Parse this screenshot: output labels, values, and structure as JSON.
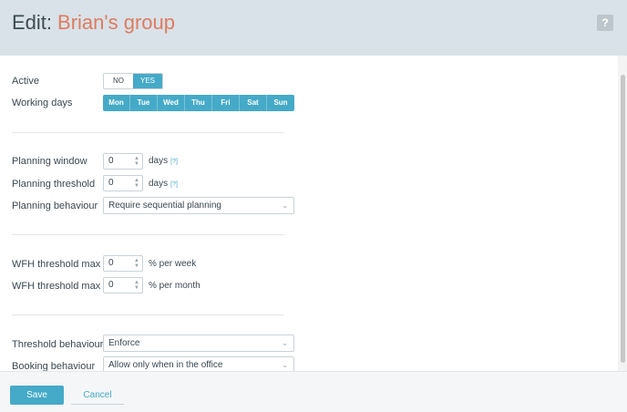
{
  "header": {
    "edit_label": "Edit:",
    "group_name": "Brian's group",
    "help_label": "?"
  },
  "active": {
    "label": "Active",
    "options": [
      "NO",
      "YES"
    ],
    "selected": "YES"
  },
  "working_days": {
    "label": "Working days",
    "days": [
      "Mon",
      "Tue",
      "Wed",
      "Thu",
      "Fri",
      "Sat",
      "Sun"
    ]
  },
  "planning_window": {
    "label": "Planning window",
    "value": "0",
    "unit": "days",
    "hint": "[?]"
  },
  "planning_threshold": {
    "label": "Planning threshold",
    "value": "0",
    "unit": "days",
    "hint": "[?]"
  },
  "planning_behaviour": {
    "label": "Planning behaviour",
    "value": "Require sequential planning"
  },
  "wfh_week": {
    "label": "WFH threshold max",
    "value": "0",
    "unit": "% per week"
  },
  "wfh_month": {
    "label": "WFH threshold max",
    "value": "0",
    "unit": "% per month"
  },
  "threshold_behaviour": {
    "label": "Threshold behaviour",
    "value": "Enforce"
  },
  "booking_behaviour": {
    "label": "Booking behaviour",
    "value": "Allow only when in the office"
  },
  "footer": {
    "save_label": "Save",
    "cancel_label": "Cancel"
  },
  "colors": {
    "accent": "#45aac7",
    "group_name": "#e07a5f",
    "header_bg": "#d8e2e8"
  },
  "icons": {
    "stepper": "up-down-arrows-icon",
    "select": "chevron-down-icon"
  }
}
